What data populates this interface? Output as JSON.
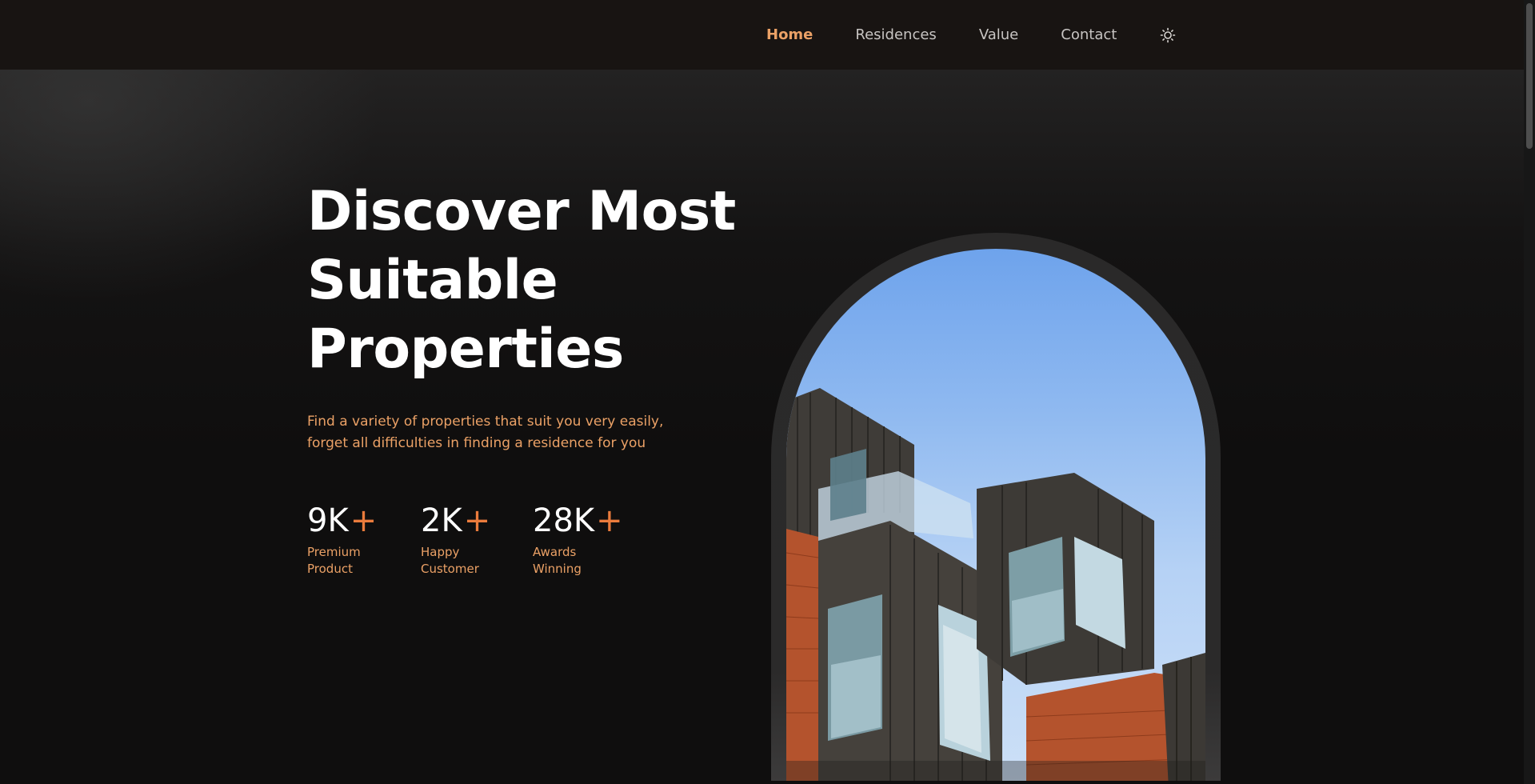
{
  "header": {
    "nav": [
      {
        "label": "Home",
        "active": true
      },
      {
        "label": "Residences",
        "active": false
      },
      {
        "label": "Value",
        "active": false
      },
      {
        "label": "Contact",
        "active": false
      }
    ],
    "theme_toggle_icon": "sun-icon"
  },
  "hero": {
    "title_lines": [
      "Discover Most",
      "Suitable",
      "Properties"
    ],
    "description_lines": [
      "Find a variety of properties that suit you very easily,",
      "forget all difficulties in finding a residence for you"
    ],
    "stats": [
      {
        "value": "9K",
        "plus": "+",
        "label_lines": [
          "Premium",
          "Product"
        ]
      },
      {
        "value": "2K",
        "plus": "+",
        "label_lines": [
          "Happy",
          "Customer"
        ]
      },
      {
        "value": "28K",
        "plus": "+",
        "label_lines": [
          "Awards",
          "Winning"
        ]
      }
    ],
    "image_icon": "building-photo"
  },
  "colors": {
    "accent": "#eba166",
    "plus_accent": "#ea7b3c",
    "header_bg": "#181412",
    "page_bg": "#0f0e0e"
  }
}
